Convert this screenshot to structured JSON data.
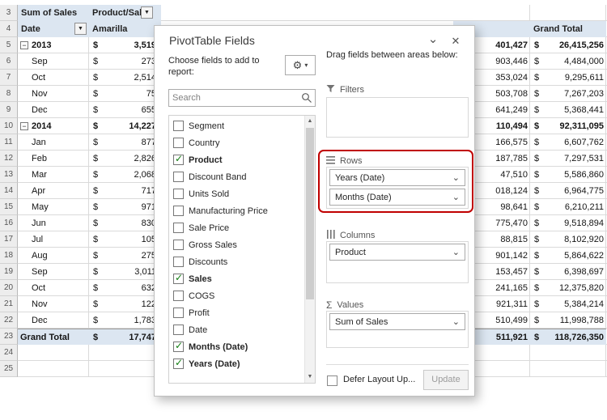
{
  "icons": {
    "close": "✕",
    "chevron_down": "⌄",
    "dropdown_arrow": "▼",
    "gear": "⚙",
    "gear_caret": "▾",
    "check": "✓",
    "collapse_minus": "−",
    "sigma": "Σ",
    "scroll_up": "▲",
    "scroll_down": "▼"
  },
  "grid": {
    "currency": "$",
    "row_numbers": [
      "3",
      "4",
      "5",
      "6",
      "7",
      "8",
      "9",
      "10",
      "11",
      "12",
      "13",
      "14",
      "15",
      "16",
      "17",
      "18",
      "19",
      "20",
      "21",
      "22",
      "23",
      "24",
      "25"
    ],
    "header3": {
      "a": "Sum of Sales",
      "b": "Product/Sales"
    },
    "header4": {
      "a": "Date",
      "b": "Amarilla",
      "total": "Grand Total"
    },
    "rows": [
      {
        "label": "2013",
        "year": true,
        "b": "3,519",
        "mid": "401,427",
        "total": "26,415,256"
      },
      {
        "label": "Sep",
        "year": false,
        "b": "273",
        "mid": "903,446",
        "total": "4,484,000"
      },
      {
        "label": "Oct",
        "year": false,
        "b": "2,514",
        "mid": "353,024",
        "total": "9,295,611"
      },
      {
        "label": "Nov",
        "year": false,
        "b": "75",
        "mid": "503,708",
        "total": "7,267,203"
      },
      {
        "label": "Dec",
        "year": false,
        "b": "655",
        "mid": "641,249",
        "total": "5,368,441"
      },
      {
        "label": "2014",
        "year": true,
        "b": "14,227",
        "mid": "110,494",
        "total": "92,311,095"
      },
      {
        "label": "Jan",
        "year": false,
        "b": "877",
        "mid": "166,575",
        "total": "6,607,762"
      },
      {
        "label": "Feb",
        "year": false,
        "b": "2,826",
        "mid": "187,785",
        "total": "7,297,531"
      },
      {
        "label": "Mar",
        "year": false,
        "b": "2,068",
        "mid": "47,510",
        "total": "5,586,860"
      },
      {
        "label": "Apr",
        "year": false,
        "b": "717",
        "mid": "018,124",
        "total": "6,964,775"
      },
      {
        "label": "May",
        "year": false,
        "b": "971",
        "mid": "98,641",
        "total": "6,210,211"
      },
      {
        "label": "Jun",
        "year": false,
        "b": "830",
        "mid": "775,470",
        "total": "9,518,894"
      },
      {
        "label": "Jul",
        "year": false,
        "b": "105",
        "mid": "88,815",
        "total": "8,102,920"
      },
      {
        "label": "Aug",
        "year": false,
        "b": "275",
        "mid": "901,142",
        "total": "5,864,622"
      },
      {
        "label": "Sep",
        "year": false,
        "b": "3,011",
        "mid": "153,457",
        "total": "6,398,697"
      },
      {
        "label": "Oct",
        "year": false,
        "b": "632",
        "mid": "241,165",
        "total": "12,375,820"
      },
      {
        "label": "Nov",
        "year": false,
        "b": "122",
        "mid": "921,311",
        "total": "5,384,214"
      },
      {
        "label": "Dec",
        "year": false,
        "b": "1,783",
        "mid": "510,499",
        "total": "11,998,788"
      }
    ],
    "grand_total": {
      "label": "Grand Total",
      "b": "17,747",
      "mid": "511,921",
      "total": "118,726,350"
    }
  },
  "dialog": {
    "title": "PivotTable Fields",
    "choose_fields_label": "Choose fields to add to report:",
    "search_placeholder": "Search",
    "fields": [
      {
        "label": "Segment",
        "checked": false
      },
      {
        "label": "Country",
        "checked": false
      },
      {
        "label": "Product",
        "checked": true
      },
      {
        "label": "Discount Band",
        "checked": false
      },
      {
        "label": "Units Sold",
        "checked": false
      },
      {
        "label": "Manufacturing Price",
        "checked": false
      },
      {
        "label": "Sale Price",
        "checked": false
      },
      {
        "label": "Gross Sales",
        "checked": false
      },
      {
        "label": "Discounts",
        "checked": false
      },
      {
        "label": "Sales",
        "checked": true
      },
      {
        "label": "COGS",
        "checked": false
      },
      {
        "label": "Profit",
        "checked": false
      },
      {
        "label": "Date",
        "checked": false
      },
      {
        "label": "Months (Date)",
        "checked": true
      },
      {
        "label": "Years (Date)",
        "checked": true
      }
    ],
    "drag_label": "Drag fields between areas below:",
    "areas": {
      "filters": {
        "label": "Filters",
        "items": []
      },
      "rows": {
        "label": "Rows",
        "items": [
          "Years (Date)",
          "Months (Date)"
        ]
      },
      "columns": {
        "label": "Columns",
        "items": [
          "Product"
        ]
      },
      "values": {
        "label": "Values",
        "items": [
          "Sum of Sales"
        ]
      }
    },
    "defer_label": "Defer Layout Up...",
    "update_label": "Update"
  }
}
